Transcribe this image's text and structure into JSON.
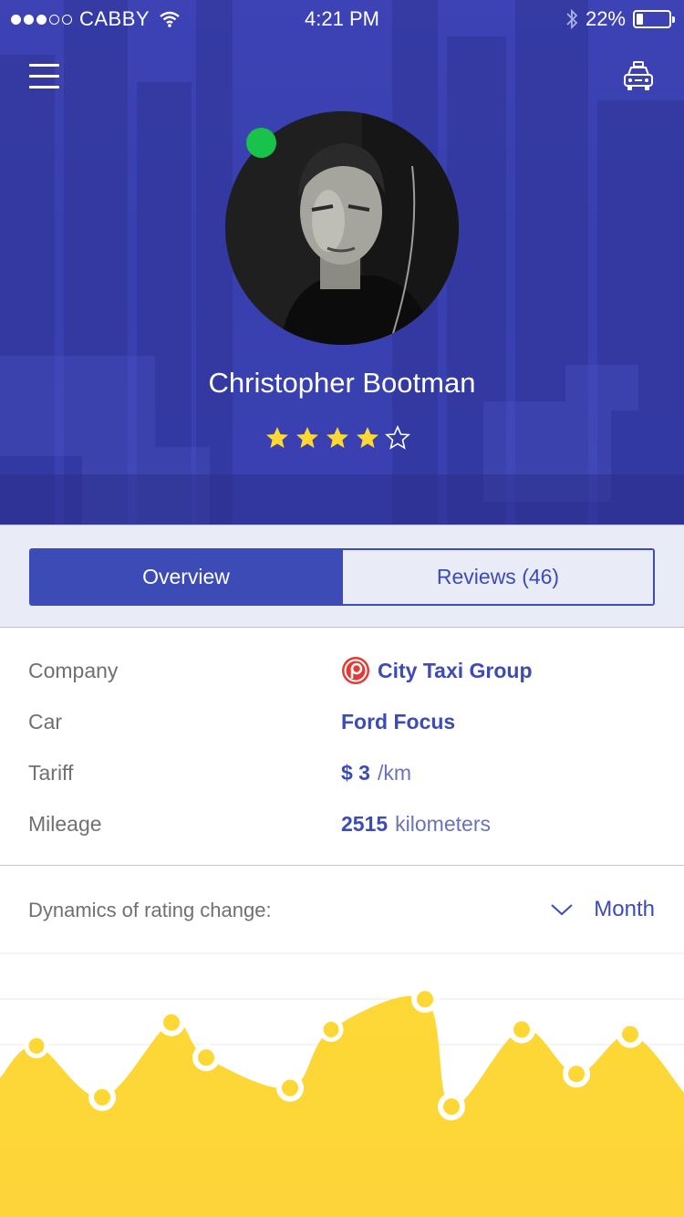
{
  "status_bar": {
    "carrier": "CABBY",
    "time": "4:21 PM",
    "battery": "22%",
    "battery_level": 0.22
  },
  "header": {
    "menu_icon": "hamburger-menu-icon",
    "taxi_icon": "taxi-icon"
  },
  "profile": {
    "name": "Christopher Bootman",
    "online": true,
    "online_color": "#19c24a",
    "rating": 4,
    "rating_max": 5
  },
  "tabs": [
    {
      "label": "Overview",
      "active": true
    },
    {
      "label": "Reviews (46)",
      "active": false
    }
  ],
  "details": {
    "company": {
      "label": "Company",
      "value": "City Taxi Group"
    },
    "car": {
      "label": "Car",
      "value": "Ford Focus"
    },
    "tariff": {
      "label": "Tariff",
      "value": "$ 3",
      "unit": "/km"
    },
    "mileage": {
      "label": "Mileage",
      "value": "2515",
      "unit": "kilometers"
    }
  },
  "chart_section": {
    "title": "Dynamics of rating change:",
    "period": "Month"
  },
  "colors": {
    "primary": "#3c4bb5",
    "hero": "#3a40b2",
    "chart_fill": "#fdd835",
    "star": "#fdd835"
  },
  "chart_data": {
    "type": "area",
    "title": "",
    "xlabel": "",
    "ylabel": "",
    "x": [
      1,
      2,
      3,
      4,
      5,
      6,
      7,
      8,
      9,
      10,
      11,
      12
    ],
    "values": [
      6.0,
      3.8,
      7.0,
      5.5,
      4.2,
      6.7,
      8.0,
      3.4,
      6.7,
      4.8,
      6.5,
      6.3
    ],
    "ylim": [
      0,
      10
    ],
    "grid": true,
    "legend": "none"
  }
}
